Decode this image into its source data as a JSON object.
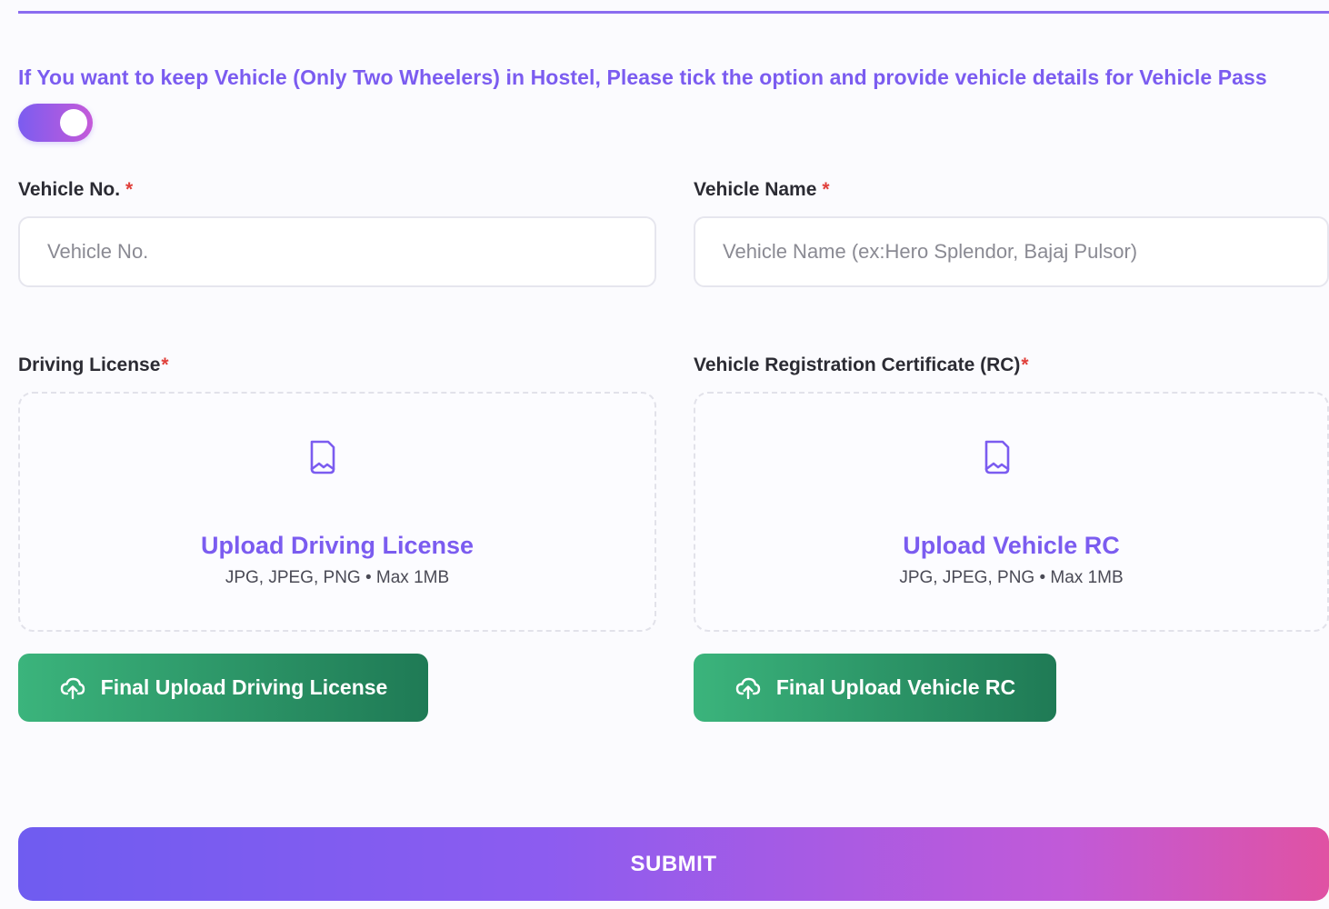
{
  "notice": {
    "text": "If You want to keep Vehicle (Only Two Wheelers) in Hostel, Please tick the option and provide vehicle details for Vehicle Pass"
  },
  "toggle": {
    "state": "on",
    "color_start": "#7b5cf0",
    "color_end": "#c55ad9"
  },
  "vehicle_no": {
    "label": "Vehicle No.",
    "required_mark": "*",
    "placeholder": "Vehicle No."
  },
  "vehicle_name": {
    "label": "Vehicle Name",
    "required_mark": "*",
    "placeholder": "Vehicle Name (ex:Hero Splendor, Bajaj Pulsor)"
  },
  "driving_license": {
    "label": "Driving License",
    "required_mark": "*",
    "upload_title": "Upload Driving License",
    "upload_hint": "JPG, JPEG, PNG • Max 1MB",
    "final_button": "Final Upload Driving License",
    "icon": "document-icon"
  },
  "vehicle_rc": {
    "label": "Vehicle Registration Certificate (RC)",
    "required_mark": "*",
    "upload_title": "Upload Vehicle RC",
    "upload_hint": "JPG, JPEG, PNG • Max 1MB",
    "final_button": "Final Upload Vehicle RC",
    "icon": "document-icon"
  },
  "submit": {
    "label": "SUBMIT"
  },
  "colors": {
    "accent": "#7b5cf0",
    "required": "#e0403b",
    "success_start": "#3bb47c",
    "success_end": "#1f7a55",
    "submit_end": "#e052a3"
  }
}
